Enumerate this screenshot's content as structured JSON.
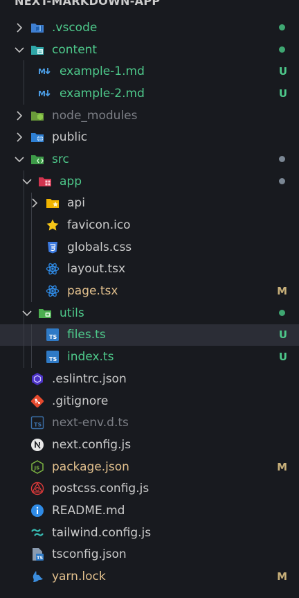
{
  "header": {
    "title": "NEXT-MARKDOWN-APP"
  },
  "colors": {
    "added": "#4ec98b",
    "modified": "#c8b07a",
    "neutral": "#7b8794"
  },
  "items": [
    {
      "label": ".vscode",
      "badge": ""
    },
    {
      "label": "content",
      "badge": ""
    },
    {
      "label": "example-1.md",
      "badge": "U"
    },
    {
      "label": "example-2.md",
      "badge": "U"
    },
    {
      "label": "node_modules",
      "badge": ""
    },
    {
      "label": "public",
      "badge": ""
    },
    {
      "label": "src",
      "badge": ""
    },
    {
      "label": "app",
      "badge": ""
    },
    {
      "label": "api",
      "badge": ""
    },
    {
      "label": "favicon.ico",
      "badge": ""
    },
    {
      "label": "globals.css",
      "badge": ""
    },
    {
      "label": "layout.tsx",
      "badge": ""
    },
    {
      "label": "page.tsx",
      "badge": "M"
    },
    {
      "label": "utils",
      "badge": ""
    },
    {
      "label": "files.ts",
      "badge": "U"
    },
    {
      "label": "index.ts",
      "badge": "U"
    },
    {
      "label": ".eslintrc.json",
      "badge": ""
    },
    {
      "label": ".gitignore",
      "badge": ""
    },
    {
      "label": "next-env.d.ts",
      "badge": ""
    },
    {
      "label": "next.config.js",
      "badge": ""
    },
    {
      "label": "package.json",
      "badge": "M"
    },
    {
      "label": "postcss.config.js",
      "badge": ""
    },
    {
      "label": "README.md",
      "badge": ""
    },
    {
      "label": "tailwind.config.js",
      "badge": ""
    },
    {
      "label": "tsconfig.json",
      "badge": ""
    },
    {
      "label": "yarn.lock",
      "badge": "M"
    }
  ]
}
